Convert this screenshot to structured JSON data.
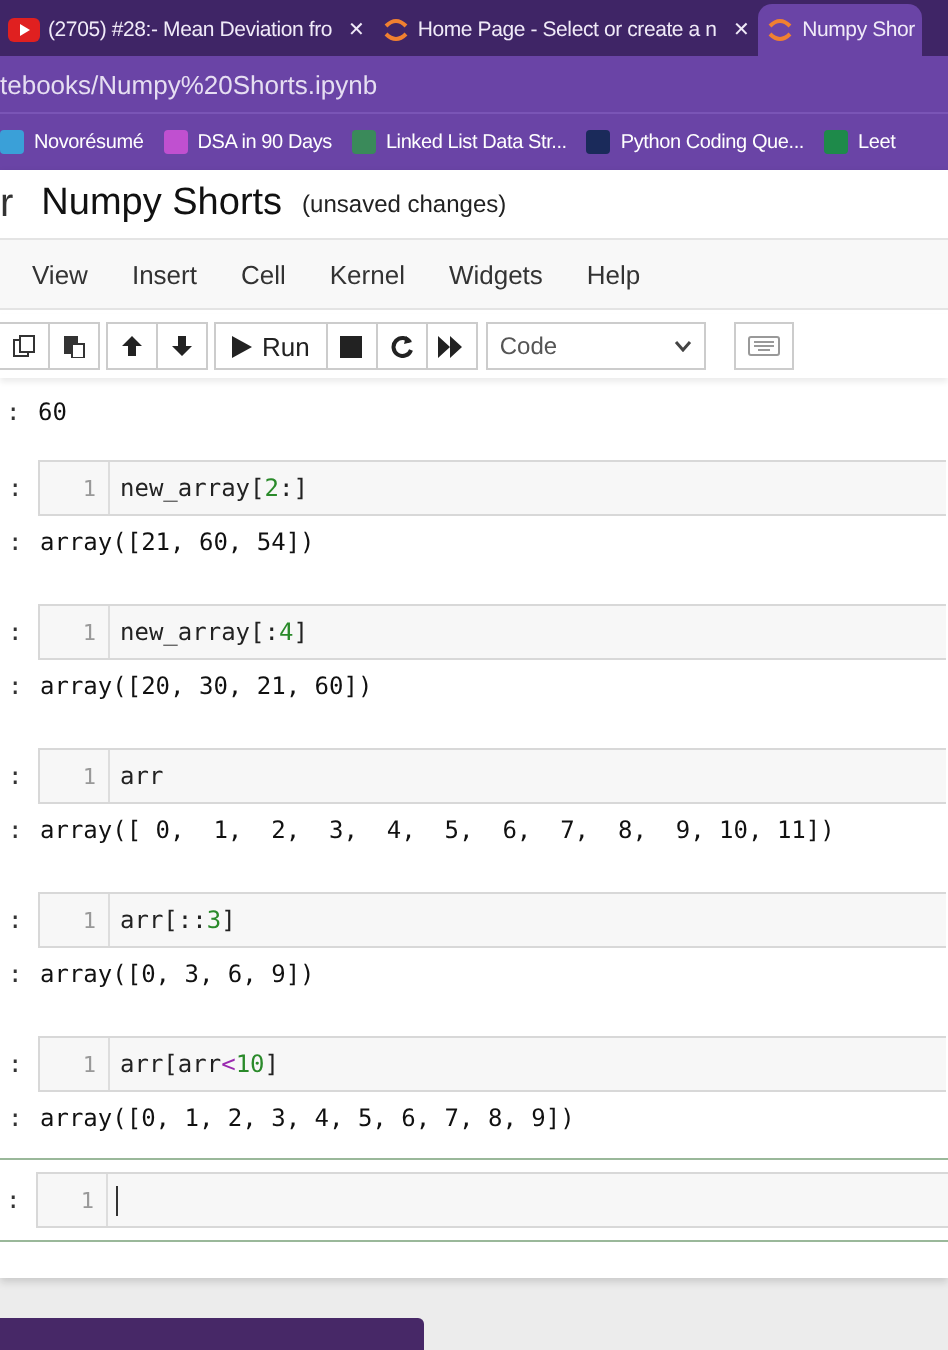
{
  "browser_tabs": [
    {
      "title": "(2705) #28:- Mean Deviation fro",
      "close": "✕",
      "selected": false
    },
    {
      "title": "Home Page - Select or create a n",
      "close": "✕",
      "selected": false
    },
    {
      "title": "Numpy Shor",
      "selected": true
    }
  ],
  "address": "tebooks/Numpy%20Shorts.ipynb",
  "bookmarks": [
    {
      "label": "Novorésumé",
      "color": "#3aa0d8"
    },
    {
      "label": "DSA in 90 Days",
      "color": "#c050d0"
    },
    {
      "label": "Linked List Data Str...",
      "color": "#3a8a5a"
    },
    {
      "label": "Python Coding Que...",
      "color": "#1a2a5a"
    },
    {
      "label": "Leet",
      "color": "#1e8a4a"
    }
  ],
  "notebook": {
    "logo_fragment": "r",
    "title": "Numpy Shorts",
    "status": "(unsaved changes)"
  },
  "menu": [
    "View",
    "Insert",
    "Cell",
    "Kernel",
    "Widgets",
    "Help"
  ],
  "toolbar": {
    "run_label": "Run",
    "cell_type": "Code"
  },
  "top_output": {
    "prompt": ":",
    "text": "60"
  },
  "cells": [
    {
      "prompt": ":",
      "line": "1",
      "code": [
        {
          "kind": "plain",
          "text": "new_array["
        },
        {
          "kind": "number",
          "text": "2"
        },
        {
          "kind": "plain",
          "text": ":]"
        }
      ],
      "output_prompt": ":",
      "output": "array([21, 60, 54])",
      "active": false
    },
    {
      "prompt": ":",
      "line": "1",
      "code": [
        {
          "kind": "plain",
          "text": "new_array[:"
        },
        {
          "kind": "number",
          "text": "4"
        },
        {
          "kind": "plain",
          "text": "]"
        }
      ],
      "output_prompt": ":",
      "output": "array([20, 30, 21, 60])",
      "active": false
    },
    {
      "prompt": ":",
      "line": "1",
      "code": [
        {
          "kind": "plain",
          "text": "arr"
        }
      ],
      "output_prompt": ":",
      "output": "array([ 0,  1,  2,  3,  4,  5,  6,  7,  8,  9, 10, 11])",
      "active": false
    },
    {
      "prompt": ":",
      "line": "1",
      "code": [
        {
          "kind": "plain",
          "text": "arr[::"
        },
        {
          "kind": "number",
          "text": "3"
        },
        {
          "kind": "plain",
          "text": "]"
        }
      ],
      "output_prompt": ":",
      "output": "array([0, 3, 6, 9])",
      "active": false
    },
    {
      "prompt": ":",
      "line": "1",
      "code": [
        {
          "kind": "plain",
          "text": "arr[arr"
        },
        {
          "kind": "operator",
          "text": "<"
        },
        {
          "kind": "number",
          "text": "10"
        },
        {
          "kind": "plain",
          "text": "]"
        }
      ],
      "output_prompt": ":",
      "output": "array([0, 1, 2, 3, 4, 5, 6, 7, 8, 9])",
      "active": false
    },
    {
      "prompt": ":",
      "line": "1",
      "active": true
    }
  ]
}
